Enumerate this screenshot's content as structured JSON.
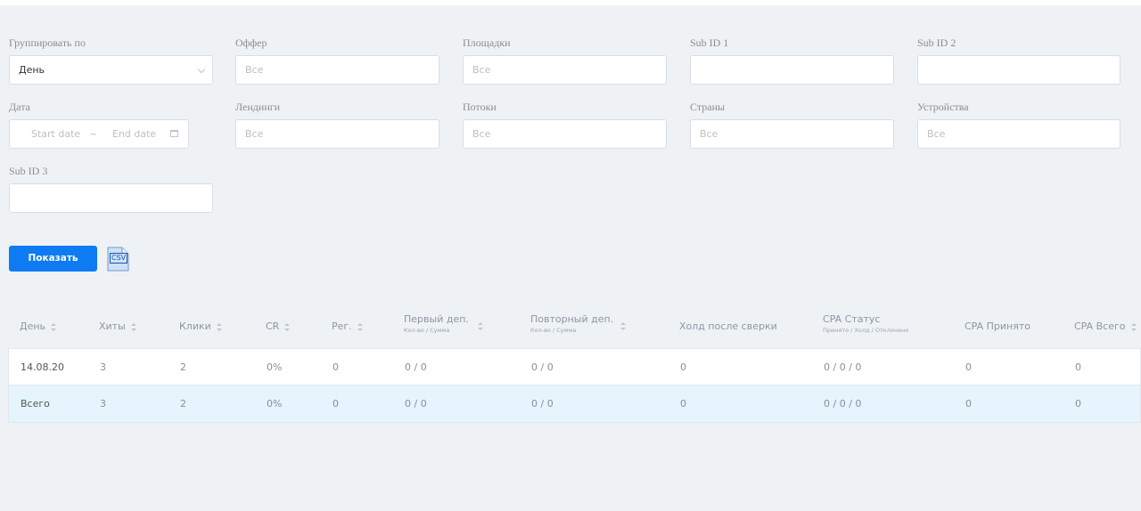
{
  "filters": {
    "group_by": {
      "label": "Группировать по",
      "value": "День"
    },
    "offer": {
      "label": "Оффер",
      "placeholder": "Все"
    },
    "platforms": {
      "label": "Площадки",
      "placeholder": "Все"
    },
    "sub_id_1": {
      "label": "Sub ID 1",
      "value": ""
    },
    "sub_id_2": {
      "label": "Sub ID 2",
      "value": ""
    },
    "date": {
      "label": "Дата",
      "start_placeholder": "Start date",
      "separator": "~",
      "end_placeholder": "End date"
    },
    "landings": {
      "label": "Лендинги",
      "placeholder": "Все"
    },
    "streams": {
      "label": "Потоки",
      "placeholder": "Все"
    },
    "countries": {
      "label": "Страны",
      "placeholder": "Все"
    },
    "devices": {
      "label": "Устройства",
      "placeholder": "Все"
    },
    "sub_id_3": {
      "label": "Sub ID 3",
      "value": ""
    }
  },
  "actions": {
    "show_label": "Показать",
    "csv_label": "CSV"
  },
  "table": {
    "columns": [
      {
        "label": "День",
        "sortable": true
      },
      {
        "label": "Хиты",
        "sortable": true
      },
      {
        "label": "Клики",
        "sortable": true
      },
      {
        "label": "CR",
        "sortable": true
      },
      {
        "label": "Рег.",
        "sortable": true
      },
      {
        "label": "Первый деп.",
        "sub": "Кол-во / Сумма",
        "sortable": true
      },
      {
        "label": "Повторный деп.",
        "sub": "Кол-во / Сумма",
        "sortable": true
      },
      {
        "label": "Холд после сверки",
        "sortable": false
      },
      {
        "label": "CPA Статус",
        "sub": "Принято / Холд / Отклонено",
        "sortable": false
      },
      {
        "label": "CPA Принято",
        "sortable": false
      },
      {
        "label": "CPA Всего",
        "sortable": true
      }
    ],
    "rows": [
      [
        "14.08.20",
        "3",
        "2",
        "0%",
        "0",
        "0 / 0",
        "0 / 0",
        "0",
        "0 / 0 / 0",
        "0",
        "0"
      ],
      [
        "Всего",
        "3",
        "2",
        "0%",
        "0",
        "0 / 0",
        "0 / 0",
        "0",
        "0 / 0 / 0",
        "0",
        "0"
      ]
    ]
  },
  "colors": {
    "background": "#eff2f5",
    "primary_button": "#0e7bf2",
    "total_row": "#e5f4fd"
  }
}
